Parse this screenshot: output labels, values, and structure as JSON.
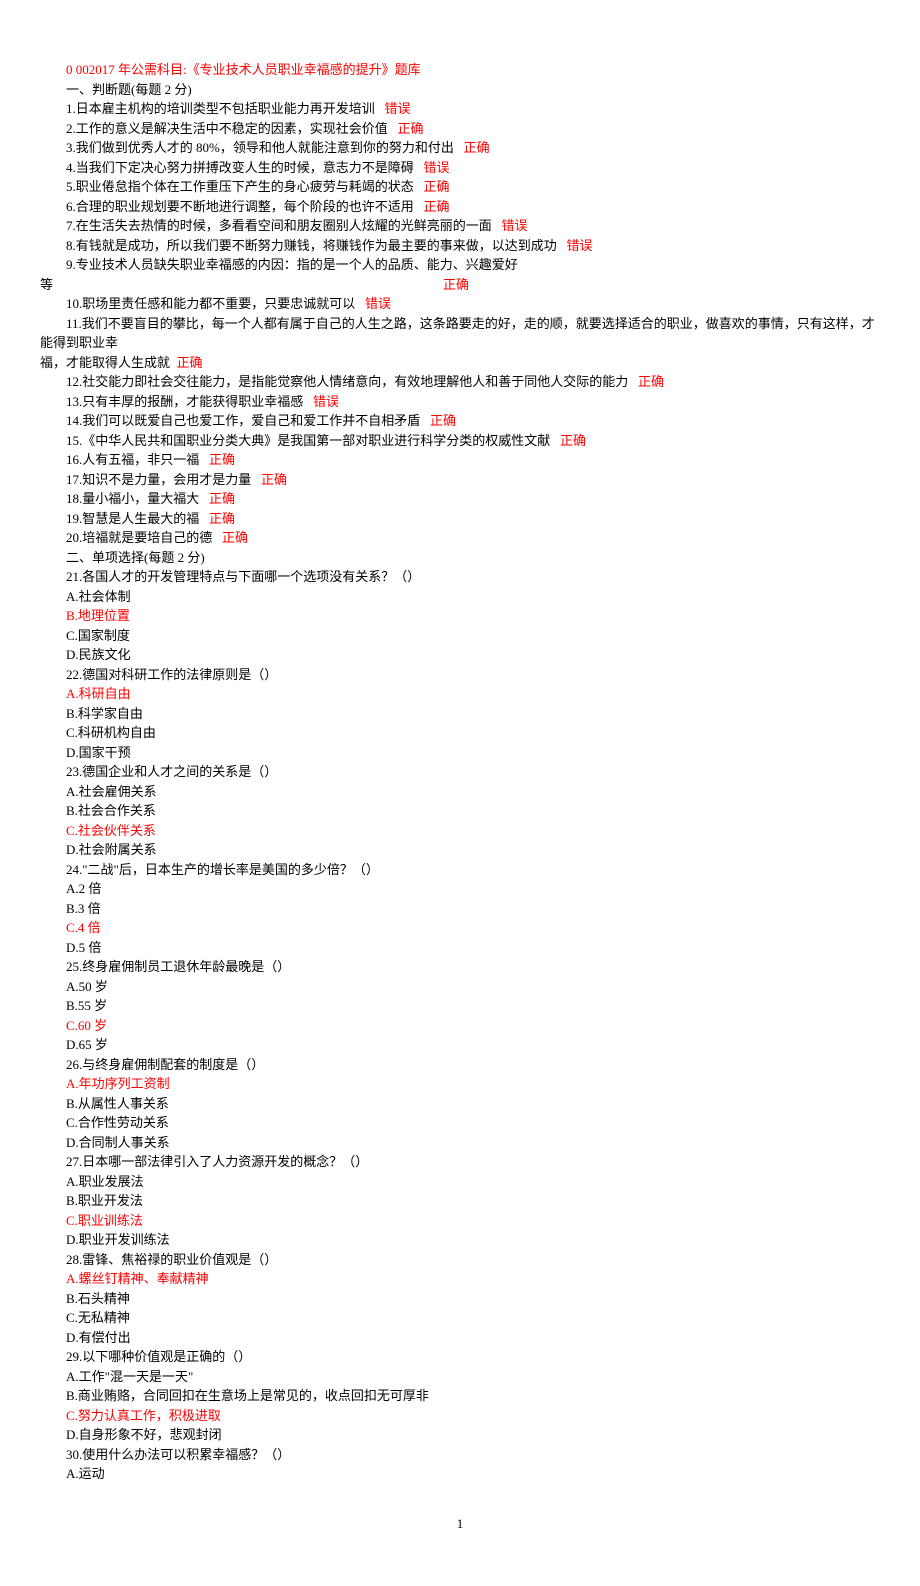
{
  "title": "0 002017 年公需科目:《专业技术人员职业幸福感的提升》题库",
  "section1_header": "一、判断题(每题 2 分)",
  "judge": [
    {
      "n": "1.",
      "text": "日本雇主机构的培训类型不包括职业能力再开发培训",
      "ans": "错误"
    },
    {
      "n": "2.",
      "text": "工作的意义是解决生活中不稳定的因素，实现社会价值",
      "ans": "正确"
    },
    {
      "n": "3.",
      "text": "我们做到优秀人才的 80%，领导和他人就能注意到你的努力和付出",
      "ans": "正确"
    },
    {
      "n": "4.",
      "text": "当我们下定决心努力拼搏改变人生的时候，意志力不是障碍",
      "ans": "错误"
    },
    {
      "n": "5.",
      "text": "职业倦怠指个体在工作重压下产生的身心疲劳与耗竭的状态",
      "ans": "正确"
    },
    {
      "n": "6.",
      "text": "合理的职业规划要不断地进行调整，每个阶段的也许不适用",
      "ans": "正确"
    },
    {
      "n": "7.",
      "text": "在生活失去热情的时候，多看看空间和朋友圈别人炫耀的光鲜亮丽的一面",
      "ans": "错误"
    },
    {
      "n": "8.",
      "text": "有钱就是成功，所以我们要不断努力赚钱，将赚钱作为最主要的事来做，以达到成功",
      "ans": "错误"
    },
    {
      "n": "9.",
      "text": "专业技术人员缺失职业幸福感的内因：指的是一个人的品质、能力、兴趣爱好等",
      "ans": "正确"
    },
    {
      "n": "10.",
      "text": "职场里责任感和能力都不重要，只要忠诚就可以",
      "ans": "错误"
    },
    {
      "n": "11.",
      "text": "我们不要盲目的攀比，每一个人都有属于自己的人生之路，这条路要走的好，走的顺，就要选择适合的职业，做喜欢的事情，只有这样，才能得到职业幸",
      "cont": "福，才能取得人生成就",
      "ans": "正确"
    },
    {
      "n": "12.",
      "text": "社交能力即社会交往能力，是指能觉察他人情绪意向，有效地理解他人和善于同他人交际的能力",
      "ans": "正确"
    },
    {
      "n": "13.",
      "text": "只有丰厚的报酬，才能获得职业幸福感",
      "ans": "错误"
    },
    {
      "n": "14.",
      "text": "我们可以既爱自己也爱工作，爱自己和爱工作并不自相矛盾",
      "ans": "正确"
    },
    {
      "n": "15.",
      "text": "《中华人民共和国职业分类大典》是我国第一部对职业进行科学分类的权威性文献",
      "ans": "正确"
    },
    {
      "n": "16.",
      "text": "人有五福，非只一福",
      "ans": "正确"
    },
    {
      "n": "17.",
      "text": "知识不是力量，会用才是力量",
      "ans": "正确"
    },
    {
      "n": "18.",
      "text": "量小福小，量大福大",
      "ans": "正确"
    },
    {
      "n": "19.",
      "text": "智慧是人生最大的福",
      "ans": "正确"
    },
    {
      "n": "20.",
      "text": "培福就是要培自己的德",
      "ans": "正确"
    }
  ],
  "section2_header": "二、单项选择(每题 2 分)",
  "mc": [
    {
      "n": "21.",
      "q": "各国人才的开发管理特点与下面哪一个选项没有关系？（）",
      "opts": [
        {
          "l": "A.",
          "t": "社会体制"
        },
        {
          "l": "B.",
          "t": "地理位置",
          "a": true
        },
        {
          "l": "C.",
          "t": "国家制度"
        },
        {
          "l": "D.",
          "t": "民族文化"
        }
      ]
    },
    {
      "n": "22.",
      "q": "德国对科研工作的法律原则是（）",
      "opts": [
        {
          "l": "A.",
          "t": "科研自由",
          "a": true
        },
        {
          "l": "B.",
          "t": "科学家自由"
        },
        {
          "l": "C.",
          "t": "科研机构自由"
        },
        {
          "l": "D.",
          "t": "国家干预"
        }
      ]
    },
    {
      "n": "23.",
      "q": "德国企业和人才之间的关系是（）",
      "opts": [
        {
          "l": "A.",
          "t": "社会雇佣关系"
        },
        {
          "l": "B.",
          "t": "社会合作关系"
        },
        {
          "l": "C.",
          "t": "社会伙伴关系",
          "a": true
        },
        {
          "l": "D.",
          "t": "社会附属关系"
        }
      ]
    },
    {
      "n": "24.",
      "q": "\"二战\"后，日本生产的增长率是美国的多少倍？（）",
      "opts": [
        {
          "l": "A.",
          "t": "2 倍"
        },
        {
          "l": "B.",
          "t": "3 倍"
        },
        {
          "l": "C.",
          "t": "4 倍",
          "a": true
        },
        {
          "l": "D.",
          "t": "5 倍"
        }
      ]
    },
    {
      "n": "25.",
      "q": "终身雇佣制员工退休年龄最晚是（）",
      "opts": [
        {
          "l": "A.",
          "t": "50 岁"
        },
        {
          "l": "B.",
          "t": "55 岁"
        },
        {
          "l": "C.",
          "t": "60 岁",
          "a": true
        },
        {
          "l": "D.",
          "t": "65 岁"
        }
      ]
    },
    {
      "n": "26.",
      "q": "与终身雇佣制配套的制度是（）",
      "opts": [
        {
          "l": "A.",
          "t": "年功序列工资制",
          "a": true
        },
        {
          "l": "B.",
          "t": "从属性人事关系"
        },
        {
          "l": "C.",
          "t": "合作性劳动关系"
        },
        {
          "l": "D.",
          "t": "合同制人事关系"
        }
      ]
    },
    {
      "n": "27.",
      "q": "日本哪一部法律引入了人力资源开发的概念？（）",
      "opts": [
        {
          "l": "A.",
          "t": "职业发展法"
        },
        {
          "l": "B.",
          "t": "职业开发法"
        },
        {
          "l": "C.",
          "t": "职业训练法",
          "a": true
        },
        {
          "l": "D.",
          "t": "职业开发训练法"
        }
      ]
    },
    {
      "n": "28.",
      "q": "雷锋、焦裕禄的职业价值观是（）",
      "opts": [
        {
          "l": "A.",
          "t": "螺丝钉精神、奉献精神",
          "a": true
        },
        {
          "l": "B.",
          "t": "石头精神"
        },
        {
          "l": "C.",
          "t": "无私精神"
        },
        {
          "l": "D.",
          "t": "有偿付出"
        }
      ]
    },
    {
      "n": "29.",
      "q": "以下哪种价值观是正确的（）",
      "opts": [
        {
          "l": "A.",
          "t": "工作\"混一天是一天\""
        },
        {
          "l": "B.",
          "t": "商业贿赂，合同回扣在生意场上是常见的，收点回扣无可厚非"
        },
        {
          "l": "C.",
          "t": "努力认真工作，积极进取",
          "a": true
        },
        {
          "l": "D.",
          "t": "自身形象不好，悲观封闭"
        }
      ]
    },
    {
      "n": "30.",
      "q": "使用什么办法可以积累幸福感？（）",
      "opts": [
        {
          "l": "A.",
          "t": "运动"
        }
      ]
    }
  ],
  "page_number": "1"
}
